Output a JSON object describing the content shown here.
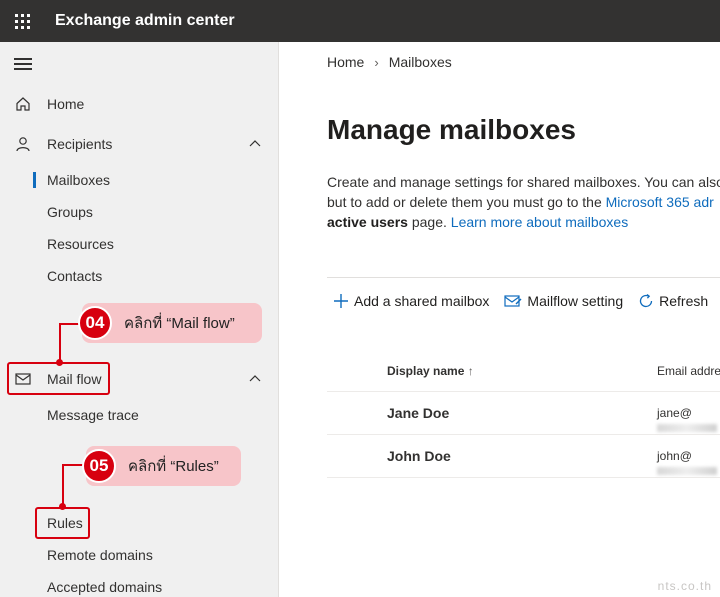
{
  "header": {
    "app_title": "Exchange admin center"
  },
  "sidebar": {
    "home": "Home",
    "recipients": "Recipients",
    "mailboxes": "Mailboxes",
    "groups": "Groups",
    "resources": "Resources",
    "contacts": "Contacts",
    "mail_flow": "Mail flow",
    "message_trace": "Message trace",
    "rules": "Rules",
    "remote_domains": "Remote domains",
    "accepted_domains": "Accepted domains"
  },
  "callouts": [
    {
      "num": "04",
      "text": "คลิกที่ “Mail flow”"
    },
    {
      "num": "05",
      "text": "คลิกที่ “Rules”"
    }
  ],
  "main": {
    "breadcrumb_home": "Home",
    "breadcrumb_current": "Mailboxes",
    "title": "Manage mailboxes",
    "desc_line1": "Create and manage settings for shared mailboxes. You can also",
    "desc_line2_a": "but to add or delete them you must go to the ",
    "desc_line2_link": "Microsoft 365 adr",
    "desc_line3_bold": "active users",
    "desc_line3_b": " page. ",
    "desc_line3_link": "Learn more about mailboxes",
    "commands": {
      "add": "Add a shared mailbox",
      "mailflow": "Mailflow setting",
      "refresh": "Refresh"
    },
    "table": {
      "col_name": "Display name",
      "col_email": "Email addre",
      "rows": [
        {
          "name": "Jane Doe",
          "email": "jane@"
        },
        {
          "name": "John Doe",
          "email": "john@"
        }
      ]
    }
  },
  "watermark": "nts.co.th",
  "colors": {
    "accent": "#0f6cbd",
    "highlight": "#d7000f",
    "callout_bg": "#f7c5c9",
    "topbar": "#333231"
  }
}
